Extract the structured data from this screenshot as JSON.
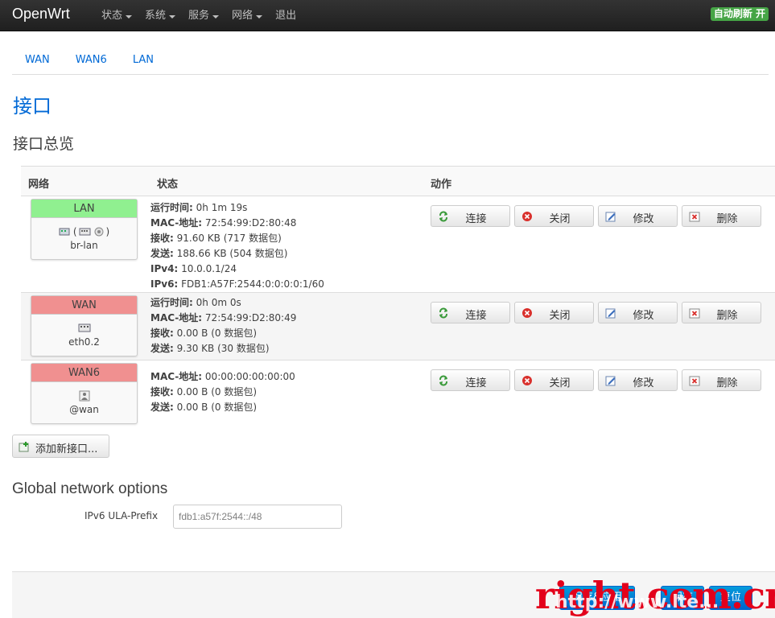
{
  "brand": "OpenWrt",
  "menu": [
    {
      "label": "状态"
    },
    {
      "label": "系统"
    },
    {
      "label": "服务"
    },
    {
      "label": "网络"
    },
    {
      "label": "退出"
    }
  ],
  "autorefresh_label": "自动刷新 开",
  "tabs": [
    "WAN",
    "WAN6",
    "LAN"
  ],
  "page_title": "接口",
  "section_title": "接口总览",
  "table": {
    "headers": {
      "network": "网络",
      "status": "状态",
      "actions": "动作"
    }
  },
  "actions": {
    "connect": "连接",
    "stop": "关闭",
    "edit": "修改",
    "delete": "删除"
  },
  "interfaces": [
    {
      "name": "LAN",
      "device": "br-lan",
      "header_color": "#90f090",
      "status": [
        {
          "k": "运行时间:",
          "v": "0h 1m 19s"
        },
        {
          "k": "MAC-地址:",
          "v": "72:54:99:D2:80:48"
        },
        {
          "k": "接收:",
          "v": "91.60 KB (717 数据包)"
        },
        {
          "k": "发送:",
          "v": "188.66 KB (504 数据包)"
        },
        {
          "k": "IPv4:",
          "v": "10.0.0.1/24"
        },
        {
          "k": "IPv6:",
          "v": "FDB1:A57F:2544:0:0:0:0:1/60"
        }
      ]
    },
    {
      "name": "WAN",
      "device": "eth0.2",
      "header_color": "#f09090",
      "status": [
        {
          "k": "运行时间:",
          "v": "0h 0m 0s"
        },
        {
          "k": "MAC-地址:",
          "v": "72:54:99:D2:80:49"
        },
        {
          "k": "接收:",
          "v": "0.00 B (0 数据包)"
        },
        {
          "k": "发送:",
          "v": "9.30 KB (30 数据包)"
        }
      ]
    },
    {
      "name": "WAN6",
      "device": "@wan",
      "header_color": "#f09090",
      "status": [
        {
          "k": "MAC-地址:",
          "v": "00:00:00:00:00:00"
        },
        {
          "k": "接收:",
          "v": "0.00 B (0 数据包)"
        },
        {
          "k": "发送:",
          "v": "0.00 B (0 数据包)"
        }
      ]
    }
  ],
  "add_interface_label": "添加新接口...",
  "global_options_title": "Global network options",
  "ula_prefix": {
    "label": "IPv6 ULA-Prefix",
    "value": "fdb1:a57f:2544::/48"
  },
  "footer_buttons": [
    "保存&应用",
    "保存",
    "复位"
  ],
  "watermark": {
    "main": "right.com.cn",
    "sub": "http://www.lte..."
  }
}
